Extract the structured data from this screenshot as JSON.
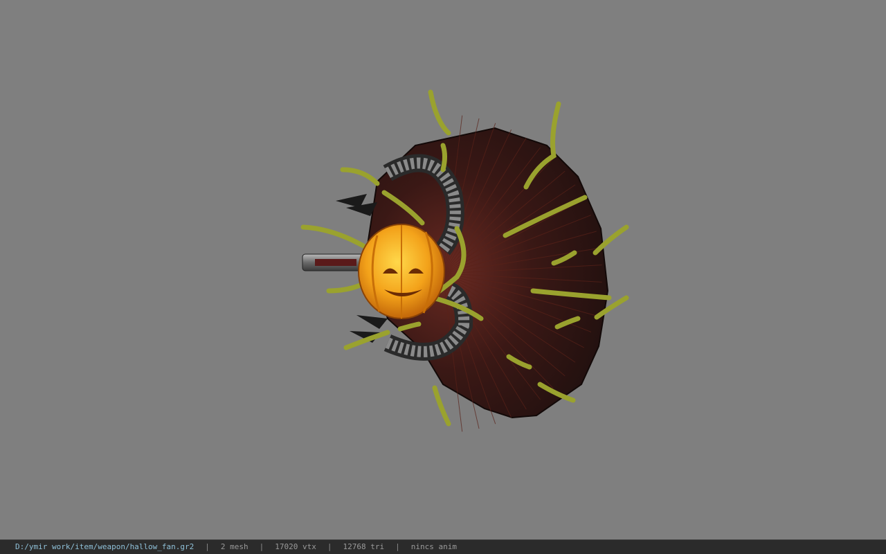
{
  "viewport": {
    "background": "#7f7f7f",
    "model_icon": "hallow-fan-model"
  },
  "status_bar": {
    "file_path": "D:/ymir work/item/weapon/hallow_fan.gr2",
    "separator": "|",
    "mesh": "2 mesh",
    "vertices": "17020 vtx",
    "triangles": "12768 tri",
    "anim": "nincs anim"
  }
}
